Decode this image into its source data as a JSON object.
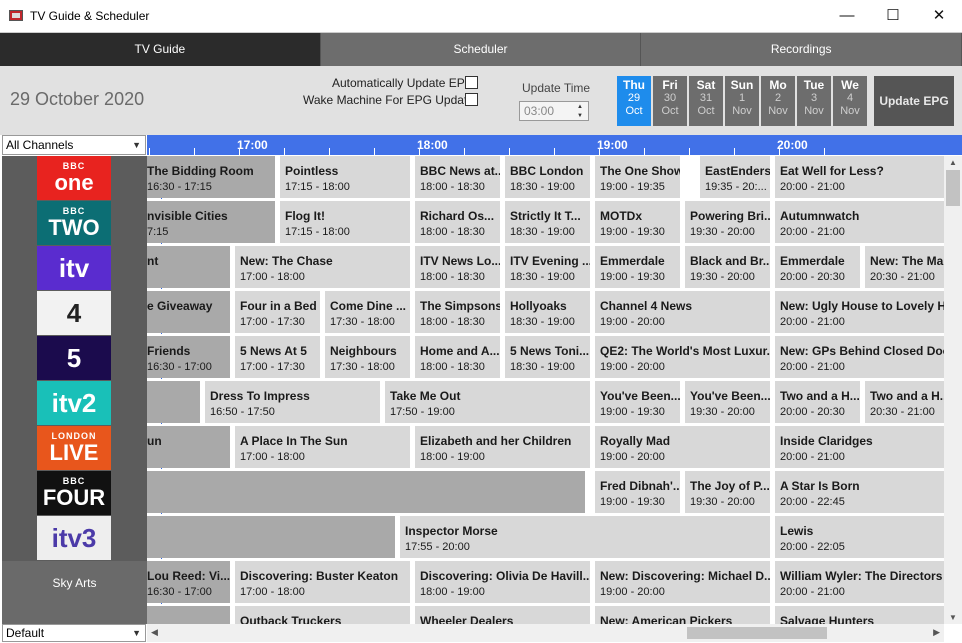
{
  "window": {
    "title": "TV Guide & Scheduler"
  },
  "window_controls": {
    "minimize": "—",
    "maximize": "☐",
    "close": "✕"
  },
  "tabs": [
    {
      "label": "TV Guide"
    },
    {
      "label": "Scheduler"
    },
    {
      "label": "Recordings"
    }
  ],
  "toolbar": {
    "date": "29 October 2020",
    "auto_update_label": "Automatically Update EPG",
    "wake_label": "Wake Machine For EPG Update",
    "update_time_label": "Update Time",
    "update_time_value": "03:00",
    "update_button": "Update EPG",
    "days": [
      {
        "name": "Thu",
        "num": "29",
        "month": "Oct"
      },
      {
        "name": "Fri",
        "num": "30",
        "month": "Oct"
      },
      {
        "name": "Sat",
        "num": "31",
        "month": "Oct"
      },
      {
        "name": "Sun",
        "num": "1",
        "month": "Nov"
      },
      {
        "name": "Mo",
        "num": "2",
        "month": "Nov"
      },
      {
        "name": "Tue",
        "num": "3",
        "month": "Nov"
      },
      {
        "name": "We",
        "num": "4",
        "month": "Nov"
      }
    ]
  },
  "channel_filter": "All Channels",
  "profile_filter": "Default",
  "timeline": [
    "17:00",
    "18:00",
    "19:00",
    "20:00"
  ],
  "channels": [
    {
      "top": "BBC",
      "big": "one",
      "color": "#e8231f"
    },
    {
      "top": "BBC",
      "big": "TWO",
      "color": "#0c6e74"
    },
    {
      "top": "",
      "big": "itv",
      "color": "#5a2ccf"
    },
    {
      "top": "",
      "big": "4",
      "color": "#f2f2f2"
    },
    {
      "top": "",
      "big": "5",
      "color": "#1b0b4d"
    },
    {
      "top": "",
      "big": "itv2",
      "color": "#19c0b8"
    },
    {
      "top": "LONDON",
      "big": "LIVE",
      "color": "#e8561c"
    },
    {
      "top": "BBC",
      "big": "FOUR",
      "color": "#111111"
    },
    {
      "top": "",
      "big": "itv3",
      "color": "#eeeeee"
    },
    {
      "text": "Sky Arts"
    },
    {
      "text": ""
    }
  ],
  "programmes": [
    [
      {
        "title": "The Bidding Room",
        "time": "16:30 - 17:15",
        "past": true
      },
      {
        "title": "Pointless",
        "time": "17:15 - 18:00"
      },
      {
        "title": "BBC News at...",
        "time": "18:00 - 18:30"
      },
      {
        "title": "BBC London",
        "time": "18:30 - 19:00"
      },
      {
        "title": "The One Show",
        "time": "19:00 - 19:35"
      },
      {
        "title": "EastEnders",
        "time": "19:35 - 20:..."
      },
      {
        "title": "Eat Well for Less?",
        "time": "20:00 - 21:00"
      }
    ],
    [
      {
        "title": "nvisible Cities",
        "time": "7:15",
        "past": true
      },
      {
        "title": "Flog It!",
        "time": "17:15 - 18:00"
      },
      {
        "title": "Richard Os...",
        "time": "18:00 - 18:30"
      },
      {
        "title": "Strictly It T...",
        "time": "18:30 - 19:00"
      },
      {
        "title": "MOTDx",
        "time": "19:00 - 19:30"
      },
      {
        "title": "Powering Bri...",
        "time": "19:30 - 20:00"
      },
      {
        "title": "Autumnwatch",
        "time": "20:00 - 21:00"
      }
    ],
    [
      {
        "title": "nt",
        "time": "",
        "past": true
      },
      {
        "title": "New: The Chase",
        "time": "17:00 - 18:00"
      },
      {
        "title": "ITV News Lo...",
        "time": "18:00 - 18:30"
      },
      {
        "title": "ITV Evening ...",
        "time": "18:30 - 19:00"
      },
      {
        "title": "Emmerdale",
        "time": "19:00 - 19:30"
      },
      {
        "title": "Black and Br...",
        "time": "19:30 - 20:00"
      },
      {
        "title": "Emmerdale",
        "time": "20:00 - 20:30"
      },
      {
        "title": "New: The Ma...",
        "time": "20:30 - 21:00"
      }
    ],
    [
      {
        "title": "e Giveaway",
        "time": "",
        "past": true
      },
      {
        "title": "Four in a Bed",
        "time": "17:00 - 17:30"
      },
      {
        "title": "Come Dine ...",
        "time": "17:30 - 18:00"
      },
      {
        "title": "The Simpsons",
        "time": "18:00 - 18:30"
      },
      {
        "title": "Hollyoaks",
        "time": "18:30 - 19:00"
      },
      {
        "title": "Channel 4 News",
        "time": "19:00 - 20:00"
      },
      {
        "title": "New: Ugly House to Lovely H...",
        "time": "20:00 - 21:00"
      }
    ],
    [
      {
        "title": "Friends",
        "time": "16:30 - 17:00",
        "past": true
      },
      {
        "title": "5 News At 5",
        "time": "17:00 - 17:30"
      },
      {
        "title": "Neighbours",
        "time": "17:30 - 18:00"
      },
      {
        "title": "Home and A...",
        "time": "18:00 - 18:30"
      },
      {
        "title": "5 News Toni...",
        "time": "18:30 - 19:00"
      },
      {
        "title": "QE2: The World's Most Luxur...",
        "time": "19:00 - 20:00"
      },
      {
        "title": "New: GPs Behind Closed Doo...",
        "time": "20:00 - 21:00"
      }
    ],
    [
      {
        "title": "",
        "time": "",
        "past": true
      },
      {
        "title": "Dress To Impress",
        "time": "16:50 - 17:50"
      },
      {
        "title": "Take Me Out",
        "time": "17:50 - 19:00"
      },
      {
        "title": "You've Been...",
        "time": "19:00 - 19:30"
      },
      {
        "title": "You've Been...",
        "time": "19:30 - 20:00"
      },
      {
        "title": "Two and a H...",
        "time": "20:00 - 20:30"
      },
      {
        "title": "Two and a H...",
        "time": "20:30 - 21:00"
      }
    ],
    [
      {
        "title": "un",
        "time": "",
        "past": true
      },
      {
        "title": "A Place In The Sun",
        "time": "17:00 - 18:00"
      },
      {
        "title": "Elizabeth and her Children",
        "time": "18:00 - 19:00"
      },
      {
        "title": "Royally Mad",
        "time": "19:00 - 20:00"
      },
      {
        "title": "Inside Claridges",
        "time": "20:00 - 21:00"
      }
    ],
    [
      {
        "title": "",
        "time": "",
        "past": true
      },
      {
        "title": "Fred Dibnah'...",
        "time": "19:00 - 19:30"
      },
      {
        "title": "The Joy of P...",
        "time": "19:30 - 20:00"
      },
      {
        "title": "A Star Is Born",
        "time": "20:00 - 22:45"
      }
    ],
    [
      {
        "title": "",
        "time": "",
        "past": true
      },
      {
        "title": "Inspector Morse",
        "time": "17:55 - 20:00"
      },
      {
        "title": "Lewis",
        "time": "20:00 - 22:05"
      }
    ],
    [
      {
        "title": "Lou Reed: Vi...",
        "time": "16:30 - 17:00",
        "past": true
      },
      {
        "title": "Discovering: Buster Keaton",
        "time": "17:00 - 18:00"
      },
      {
        "title": "Discovering: Olivia De Havill...",
        "time": "18:00 - 19:00"
      },
      {
        "title": "New: Discovering: Michael D...",
        "time": "19:00 - 20:00"
      },
      {
        "title": "William Wyler: The Directors",
        "time": "20:00 - 21:00"
      }
    ],
    [
      {
        "title": "",
        "time": "",
        "past": true
      },
      {
        "title": "Outback Truckers",
        "time": ""
      },
      {
        "title": "Wheeler Dealers",
        "time": ""
      },
      {
        "title": "New: American Pickers",
        "time": ""
      },
      {
        "title": "Salvage Hunters",
        "time": ""
      }
    ]
  ]
}
